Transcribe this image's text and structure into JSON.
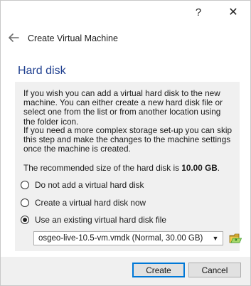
{
  "titlebar": {
    "help_label": "?",
    "close_label": "✕"
  },
  "header": {
    "title": "Create Virtual Machine"
  },
  "page": {
    "section_title": "Hard disk",
    "paragraph1": "If you wish you can add a virtual hard disk to the new machine. You can either create a new hard disk file or select one from the list or from another location using the folder icon.",
    "paragraph2": "If you need a more complex storage set-up you can skip this step and make the changes to the machine settings once the machine is created.",
    "recommended_prefix": "The recommended size of the hard disk is ",
    "recommended_size": "10.00 GB",
    "recommended_suffix": ".",
    "options": [
      {
        "label": "Do not add a virtual hard disk",
        "checked": false
      },
      {
        "label": "Create a virtual hard disk now",
        "checked": false
      },
      {
        "label": "Use an existing virtual hard disk file",
        "checked": true
      }
    ],
    "disk_select": {
      "value": "osgeo-live-10.5-vm.vmdk (Normal, 30.00 GB)"
    }
  },
  "footer": {
    "create_label": "Create",
    "cancel_label": "Cancel"
  },
  "icons": {
    "back": "back-arrow-icon",
    "folder": "folder-open-icon",
    "dropdown": "chevron-down-icon"
  },
  "colors": {
    "section_title": "#1f3f8f",
    "primary_border": "#0078d7",
    "folder_green": "#3a9a2b",
    "folder_yellow": "#f2c94c"
  }
}
